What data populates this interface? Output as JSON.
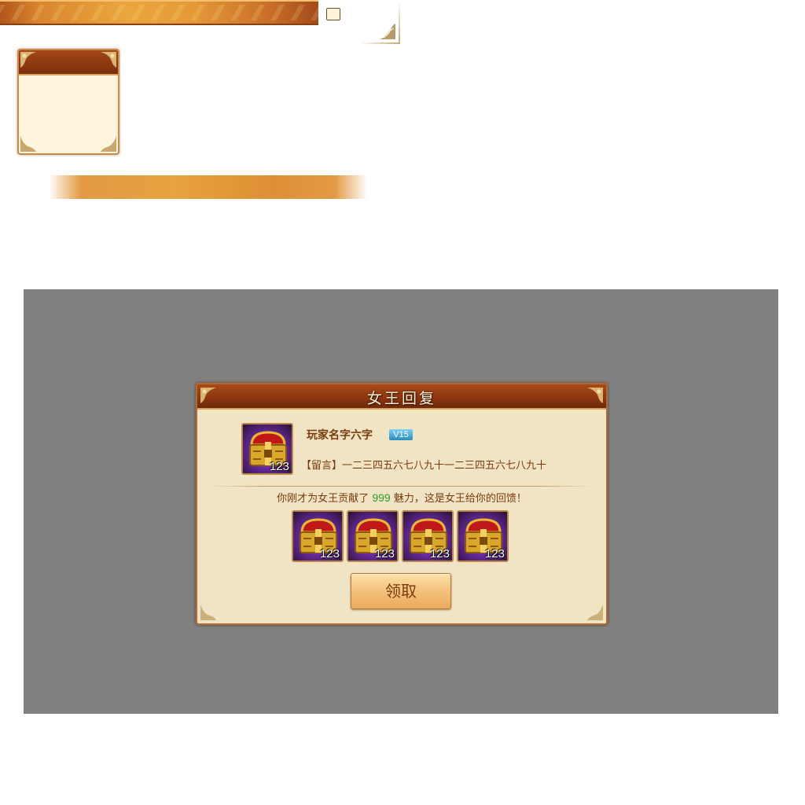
{
  "dialog": {
    "title": "女王回复",
    "player_name": "玩家名字六字",
    "vip_level": "V15",
    "message": "【留言】一二三四五六七八九十一二三四五六七八九十",
    "contribution_prefix": "你刚才为女王贡献了",
    "contribution_amount": "999",
    "contribution_suffix": "魅力，这是女王给你的回馈！",
    "avatar_item_count": "123",
    "reward_items": [
      {
        "icon": "treasure-chest-icon",
        "count": "123"
      },
      {
        "icon": "treasure-chest-icon",
        "count": "123"
      },
      {
        "icon": "treasure-chest-icon",
        "count": "123"
      },
      {
        "icon": "treasure-chest-icon",
        "count": "123"
      }
    ],
    "claim_label": "领取"
  },
  "colors": {
    "overlay": "#808080",
    "dialog_bg": "#f1e4c4",
    "title_bar": "#8a3510",
    "text_brown": "#7a3a0c",
    "highlight_green": "#2aa12a",
    "button_gold": "#f4c27c"
  }
}
